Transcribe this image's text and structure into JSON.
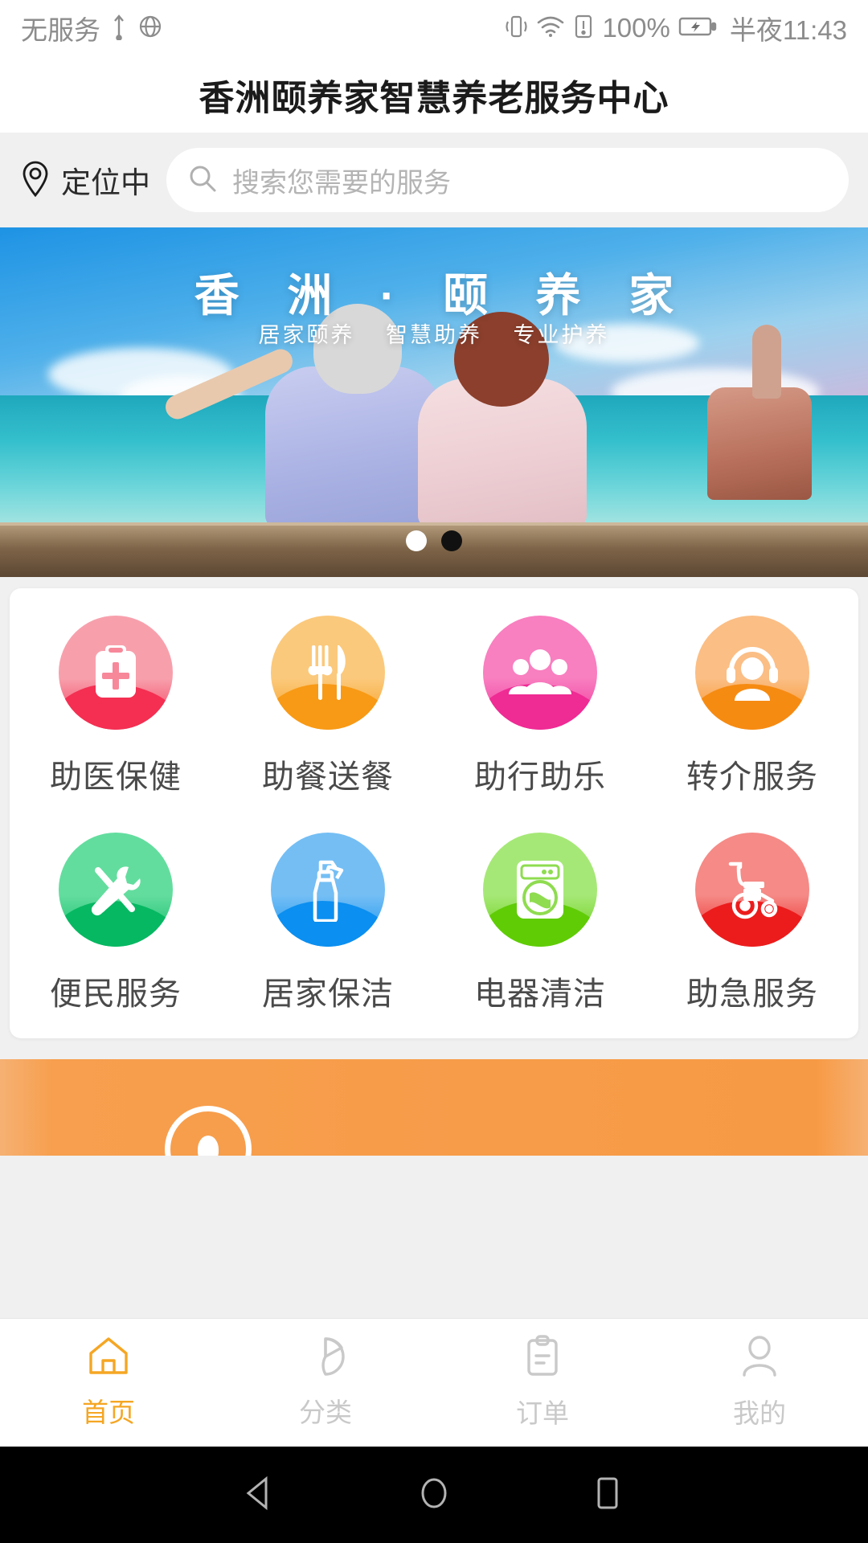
{
  "statusbar": {
    "carrier": "无服务",
    "usb_icon": "usb-icon",
    "globe_icon": "globe-icon",
    "vibrate_icon": "vibrate-icon",
    "wifi_icon": "wifi-icon",
    "sim_alert_icon": "sim-alert-icon",
    "battery_percent": "100%",
    "battery_icon": "battery-charging-icon",
    "time": "半夜11:43"
  },
  "header": {
    "title": "香洲颐养家智慧养老服务中心"
  },
  "search": {
    "location_icon": "location-pin-icon",
    "location_label": "定位中",
    "search_icon": "search-icon",
    "placeholder": "搜索您需要的服务"
  },
  "banner": {
    "title": "香 洲 · 颐 养 家",
    "subtitles": [
      "居家颐养",
      "智慧助养",
      "专业护养"
    ],
    "dots": [
      {
        "state": "active",
        "color": "#ffffff"
      },
      {
        "state": "inactive",
        "color": "#111111"
      }
    ]
  },
  "services": {
    "rows": [
      [
        {
          "label": "助医保健",
          "icon": "medical-kit-icon",
          "top": "#f7a0ac",
          "bottom": "#f42f52"
        },
        {
          "label": "助餐送餐",
          "icon": "cutlery-icon",
          "top": "#fbc97c",
          "bottom": "#f89a15"
        },
        {
          "label": "助行助乐",
          "icon": "people-group-icon",
          "top": "#f87fc0",
          "bottom": "#ef2b94"
        },
        {
          "label": "转介服务",
          "icon": "headset-agent-icon",
          "top": "#fbbe85",
          "bottom": "#f68b12"
        }
      ],
      [
        {
          "label": "便民服务",
          "icon": "tools-icon",
          "top": "#63dd9e",
          "bottom": "#06b862"
        },
        {
          "label": "居家保洁",
          "icon": "spray-bottle-icon",
          "top": "#74bef4",
          "bottom": "#0b8ff0"
        },
        {
          "label": "电器清洁",
          "icon": "washing-machine-icon",
          "top": "#a6e877",
          "bottom": "#60cc06"
        },
        {
          "label": "助急服务",
          "icon": "wheelchair-icon",
          "top": "#f58a86",
          "bottom": "#ec1c1c"
        }
      ]
    ]
  },
  "promo": {
    "bubble_icon": "chat-bubble-icon",
    "accent": "#f79a45"
  },
  "tabbar": {
    "active_color": "#f5a623",
    "inactive_color": "#c9c9c9",
    "items": [
      {
        "label": "首页",
        "icon": "home-icon",
        "active": true
      },
      {
        "label": "分类",
        "icon": "pie-chart-icon",
        "active": false
      },
      {
        "label": "订单",
        "icon": "clipboard-icon",
        "active": false
      },
      {
        "label": "我的",
        "icon": "person-icon",
        "active": false
      }
    ]
  },
  "navbar": {
    "back_icon": "android-back-icon",
    "home_icon": "android-home-icon",
    "recents_icon": "android-recents-icon"
  }
}
